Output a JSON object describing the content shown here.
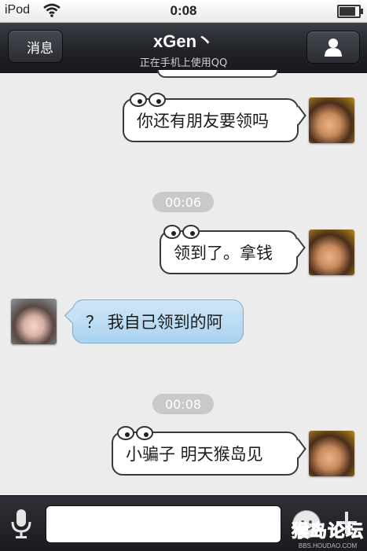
{
  "status_bar": {
    "carrier": "iPod",
    "time": "0:08",
    "battery_level": 0.85
  },
  "nav": {
    "back_label": "消息",
    "title": "xGen丶",
    "subtitle": "正在手机上使用QQ"
  },
  "messages": [
    {
      "side": "out",
      "text": "你还有朋友要领吗"
    },
    {
      "time": "00:06"
    },
    {
      "side": "out",
      "text": "领到了。拿钱"
    },
    {
      "side": "in",
      "text": "？ 我自己领到的阿"
    },
    {
      "time": "00:08"
    },
    {
      "side": "out",
      "text": "小骗子 明天猴岛见"
    }
  ],
  "input": {
    "placeholder": ""
  },
  "watermark": {
    "logo_text": "猴岛论坛",
    "url": "BBS.HOUDAO.COM"
  },
  "colors": {
    "incoming_bubble": "#b5daf3",
    "outgoing_bubble": "#ffffff",
    "nav_bg": "#24262b"
  }
}
